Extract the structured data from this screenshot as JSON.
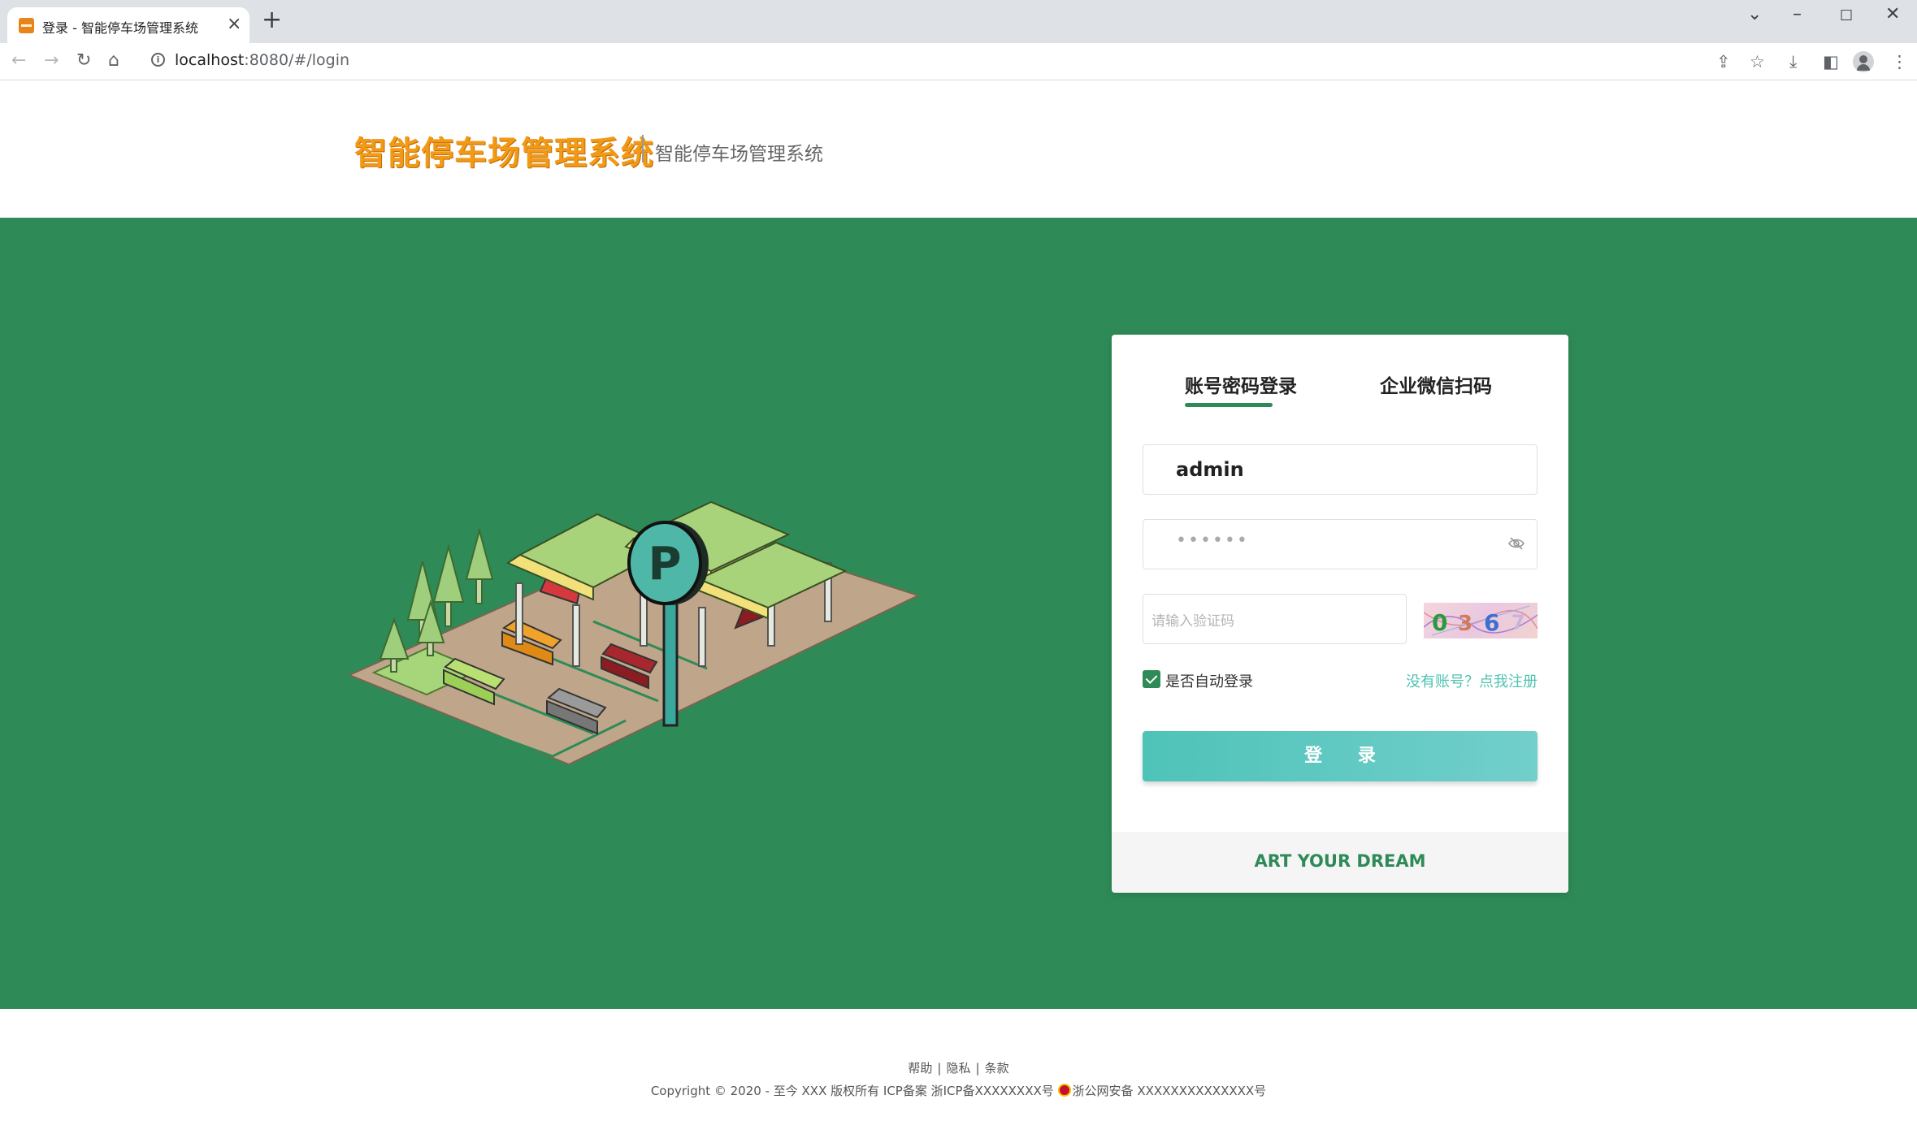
{
  "browser": {
    "tab_title": "登录 - 智能停车场管理系统",
    "url_host": "localhost",
    "url_path": ":8080/#/login",
    "icons": [
      "back-icon",
      "forward-icon",
      "reload-icon",
      "home-icon",
      "info-icon",
      "share-icon",
      "star-icon",
      "download-icon",
      "sidebar-icon",
      "profile-icon",
      "menu-icon"
    ]
  },
  "header": {
    "logo_text": "智能停车场管理系统",
    "subtitle": "智能停车场管理系统"
  },
  "login": {
    "tab_account": "账号密码登录",
    "tab_wechat": "企业微信扫码",
    "username_value": "admin",
    "password_mask": "••••••",
    "captcha_placeholder": "请输入验证码",
    "captcha_chars": [
      "0",
      "3",
      "6",
      "7"
    ],
    "remember_label": "是否自动登录",
    "remember_checked": true,
    "register_link": "没有账号？点我注册",
    "submit_label": "登 录",
    "motto": "ART YOUR DREAM"
  },
  "footer": {
    "links": [
      "帮助",
      "隐私",
      "条款"
    ],
    "separator": "|",
    "copyright": "Copyright © 2020 - 至今 XXX 版权所有 ICP备案 浙ICP备XXXXXXXX号",
    "police": "浙公网安备 XXXXXXXXXXXXXX号"
  },
  "colors": {
    "brand_green": "#2e8b57",
    "logo_orange": "#f29a16",
    "button_teal": "#4fc3b8",
    "link_teal": "#4fc3b0"
  }
}
